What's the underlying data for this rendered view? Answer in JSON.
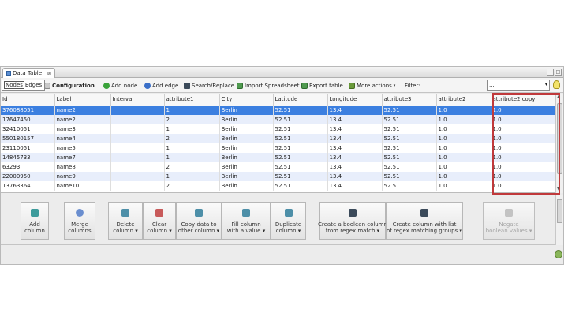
{
  "tab": {
    "title": "Data Table",
    "close": "⊠"
  },
  "window": {
    "min": "–",
    "max": "□"
  },
  "toolbar": {
    "nodes_label": "Nodes",
    "edges_label": "Edges",
    "configuration_label": "Configuration",
    "add_node": "Add node",
    "add_edge": "Add edge",
    "search_replace": "Search/Replace",
    "import_spreadsheet": "Import Spreadsheet",
    "export_table": "Export table",
    "more_actions": "More actions",
    "filter": "Filter:",
    "filter_value": "...",
    "select_arrow": "▾"
  },
  "table": {
    "columns": [
      "Id",
      "Label",
      "Interval",
      "attribute1",
      "City",
      "Latitude",
      "Longitude",
      "attribute3",
      "attribute2",
      "attribute2 copy"
    ],
    "rows": [
      [
        "376088051",
        "name2",
        "",
        "1",
        "Berlin",
        "52.51",
        "13.4",
        "52.51",
        "1.0",
        "1.0"
      ],
      [
        "17647450",
        "name2",
        "",
        "2",
        "Berlin",
        "52.51",
        "13.4",
        "52.51",
        "1.0",
        "1.0"
      ],
      [
        "32410051",
        "name3",
        "",
        "1",
        "Berlin",
        "52.51",
        "13.4",
        "52.51",
        "1.0",
        "1.0"
      ],
      [
        "550180157",
        "name4",
        "",
        "2",
        "Berlin",
        "52.51",
        "13.4",
        "52.51",
        "1.0",
        "1.0"
      ],
      [
        "23110051",
        "name5",
        "",
        "1",
        "Berlin",
        "52.51",
        "13.4",
        "52.51",
        "1.0",
        "1.0"
      ],
      [
        "14845733",
        "name7",
        "",
        "1",
        "Berlin",
        "52.51",
        "13.4",
        "52.51",
        "1.0",
        "1.0"
      ],
      [
        "63293",
        "name8",
        "",
        "2",
        "Berlin",
        "52.51",
        "13.4",
        "52.51",
        "1.0",
        "1.0"
      ],
      [
        "22000950",
        "name9",
        "",
        "1",
        "Berlin",
        "52.51",
        "13.4",
        "52.51",
        "1.0",
        "1.0"
      ],
      [
        "13763364",
        "name10",
        "",
        "2",
        "Berlin",
        "52.51",
        "13.4",
        "52.51",
        "1.0",
        "1.0"
      ]
    ],
    "selected_row": 0
  },
  "actions": {
    "add_column": [
      "Add",
      "column"
    ],
    "merge_columns": [
      "Merge",
      "columns"
    ],
    "delete_column": [
      "Delete",
      "column ▾"
    ],
    "clear_column": [
      "Clear",
      "column ▾"
    ],
    "copy_data": [
      "Copy data to",
      "other column ▾"
    ],
    "fill_column": [
      "Fill column",
      "with a value ▾"
    ],
    "duplicate_column": [
      "Duplicate",
      "column ▾"
    ],
    "create_boolean": [
      "Create a boolean column",
      "from regex match ▾"
    ],
    "create_list": [
      "Create column with list",
      "of regex matching groups ▾"
    ],
    "negate_boolean": [
      "Negate",
      "boolean values ▾"
    ]
  },
  "colors": {
    "selection": "#3b7fe0",
    "alt_row": "#e8eefb",
    "highlight": "#c0393b"
  }
}
